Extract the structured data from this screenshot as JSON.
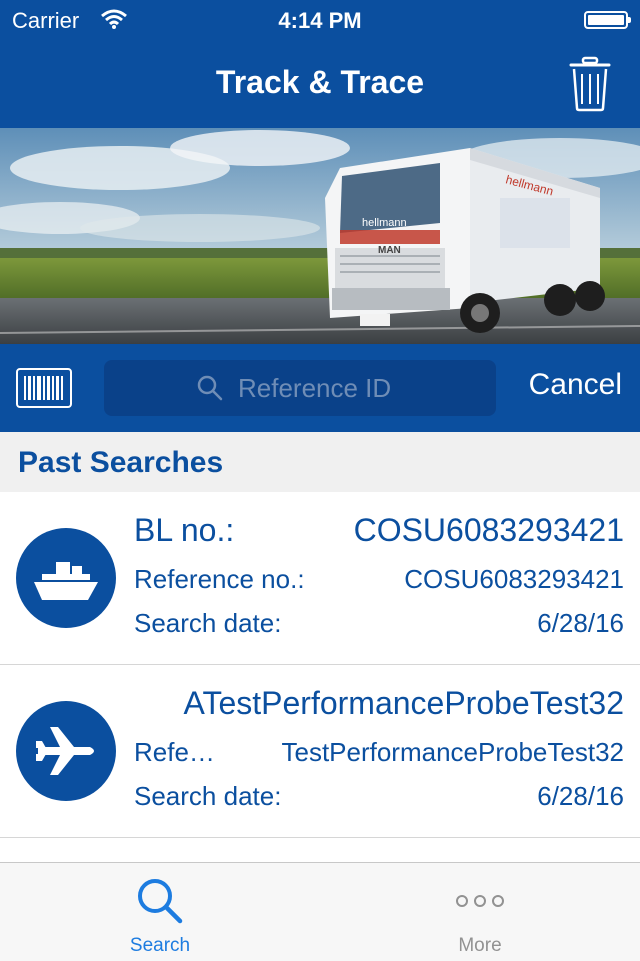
{
  "status_bar": {
    "carrier": "Carrier",
    "time": "4:14 PM"
  },
  "nav": {
    "title": "Track & Trace",
    "trash_icon": "trash-icon"
  },
  "hero": {
    "truck_brand": "hellmann"
  },
  "search": {
    "placeholder": "Reference ID",
    "value": "",
    "cancel_label": "Cancel",
    "barcode_icon": "barcode-icon"
  },
  "past_searches": {
    "header": "Past Searches",
    "items": [
      {
        "icon": "ship-icon",
        "title_label": "BL no.:",
        "title_value": "COSU6083293421",
        "ref_label": "Reference no.:",
        "ref_value": "COSU6083293421",
        "date_label": "Search date:",
        "date_value": "6/28/16"
      },
      {
        "icon": "airplane-icon",
        "title_label": "",
        "title_value": "ATestPerformanceProbeTest32",
        "ref_label": "Refe…",
        "ref_value": "TestPerformanceProbeTest32",
        "date_label": "Search date:",
        "date_value": "6/28/16"
      }
    ]
  },
  "tab_bar": {
    "tabs": [
      {
        "label": "Search",
        "icon": "search-icon",
        "selected": true
      },
      {
        "label": "More",
        "icon": "more-icon",
        "selected": false
      }
    ]
  },
  "colors": {
    "brand_blue": "#0b4f9f",
    "tab_active": "#1d7ce0",
    "tab_inactive": "#929292"
  }
}
